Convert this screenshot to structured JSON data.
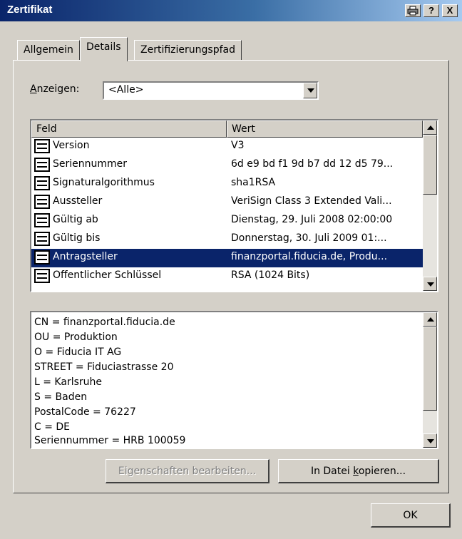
{
  "window": {
    "title": "Zertifikat",
    "help_label": "?",
    "close_label": "X"
  },
  "tabs": [
    {
      "label": "Allgemein"
    },
    {
      "label": "Details"
    },
    {
      "label": "Zertifizierungspfad"
    }
  ],
  "show": {
    "label": "Anzeigen:",
    "value": "<Alle>"
  },
  "list": {
    "columns": {
      "field": "Feld",
      "value": "Wert"
    },
    "rows": [
      {
        "field": "Version",
        "value": "V3",
        "selected": false
      },
      {
        "field": "Seriennummer",
        "value": "6d e9 bd f1 9d b7 dd 12 d5 79...",
        "selected": false
      },
      {
        "field": "Signaturalgorithmus",
        "value": "sha1RSA",
        "selected": false
      },
      {
        "field": "Aussteller",
        "value": "VeriSign Class 3 Extended Vali...",
        "selected": false
      },
      {
        "field": "Gültig ab",
        "value": "Dienstag, 29. Juli 2008 02:00:00",
        "selected": false
      },
      {
        "field": "Gültig bis",
        "value": "Donnerstag, 30. Juli 2009 01:...",
        "selected": false
      },
      {
        "field": "Antragsteller",
        "value": "finanzportal.fiducia.de, Produ...",
        "selected": true
      },
      {
        "field": "Öffentlicher Schlüssel",
        "value": "RSA (1024 Bits)",
        "selected": false
      }
    ]
  },
  "detail_lines": [
    "CN = finanzportal.fiducia.de",
    "OU = Produktion",
    "O = Fiducia IT AG",
    "STREET = Fiduciastrasse 20",
    "L = Karlsruhe",
    "S = Baden",
    "PostalCode = 76227",
    "C = DE",
    "Seriennummer = HRB 100059"
  ],
  "buttons": {
    "edit_properties": "Eigenschaften bearbeiten...",
    "copy_to_file_pre": "In Datei ",
    "copy_to_file_key": "k",
    "copy_to_file_post": "opieren...",
    "ok": "OK"
  },
  "colors": {
    "selection": "#0a246a",
    "face": "#d4d0c8"
  }
}
